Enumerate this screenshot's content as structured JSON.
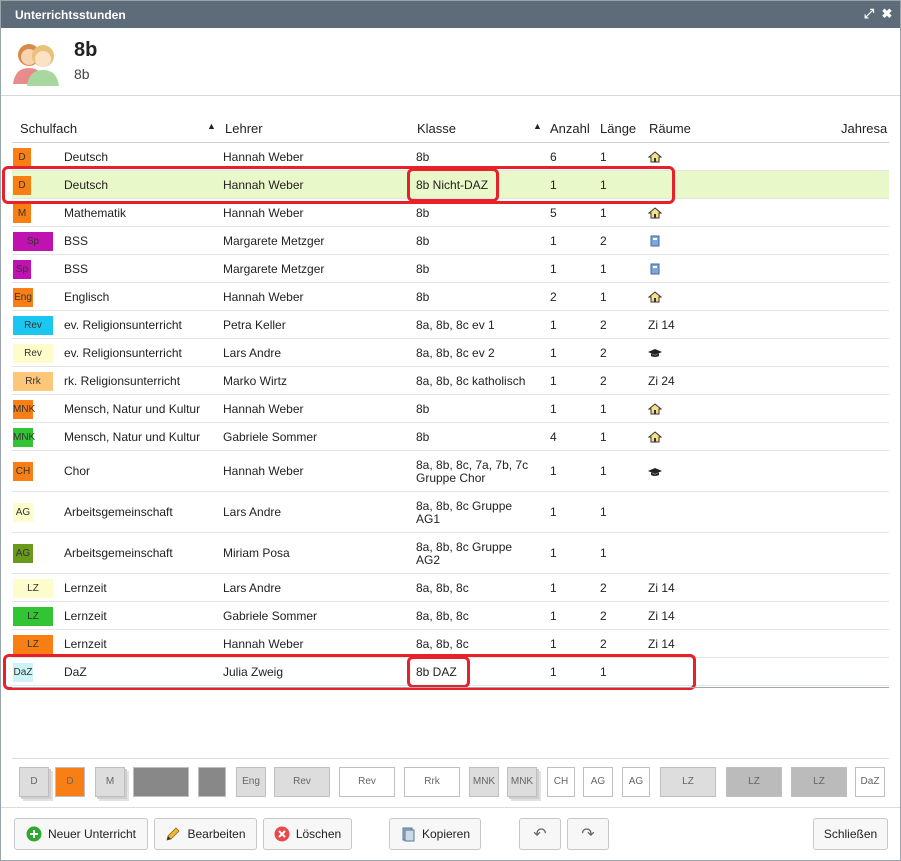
{
  "window": {
    "title": "Unterrichtsstunden"
  },
  "header": {
    "title": "8b",
    "subtitle": "8b"
  },
  "columns": {
    "schulfach": "Schulfach",
    "lehrer": "Lehrer",
    "klasse": "Klasse",
    "anzahl": "Anzahl",
    "laenge": "Länge",
    "raeume": "Räume",
    "jahresa": "Jahresa"
  },
  "rows": [
    {
      "chip": "D",
      "chipColor": "#f97f15",
      "chipW": 18,
      "fach": "Deutsch",
      "lehrer": "Hannah Weber",
      "klasse": [
        "8b"
      ],
      "anzahl": "6",
      "laenge": "1",
      "raum": "",
      "roomIcon": "house"
    },
    {
      "chip": "D",
      "chipColor": "#f97f15",
      "chipW": 18,
      "fach": "Deutsch",
      "lehrer": "Hannah Weber",
      "klasse": [
        "8b Nicht-DAZ"
      ],
      "anzahl": "1",
      "laenge": "1",
      "raum": "",
      "roomIcon": ""
    },
    {
      "chip": "M",
      "chipColor": "#f97f15",
      "chipW": 18,
      "fach": "Mathematik",
      "lehrer": "Hannah Weber",
      "klasse": [
        "8b"
      ],
      "anzahl": "5",
      "laenge": "1",
      "raum": "",
      "roomIcon": "house"
    },
    {
      "chip": "Sp",
      "chipColor": "#c012b0",
      "chipW": 40,
      "fach": "BSS",
      "lehrer": "Margarete Metzger",
      "klasse": [
        "8b"
      ],
      "anzahl": "1",
      "laenge": "2",
      "raum": "",
      "roomIcon": "book"
    },
    {
      "chip": "Sp",
      "chipColor": "#c012b0",
      "chipW": 18,
      "fach": "BSS",
      "lehrer": "Margarete Metzger",
      "klasse": [
        "8b"
      ],
      "anzahl": "1",
      "laenge": "1",
      "raum": "",
      "roomIcon": "book"
    },
    {
      "chip": "Eng",
      "chipColor": "#f97f15",
      "chipW": 20,
      "fach": "Englisch",
      "lehrer": "Hannah Weber",
      "klasse": [
        "8b"
      ],
      "anzahl": "2",
      "laenge": "1",
      "raum": "",
      "roomIcon": "house"
    },
    {
      "chip": "Rev",
      "chipColor": "#1bc6f0",
      "chipW": 40,
      "fach": "ev. Religionsunterricht",
      "lehrer": "Petra Keller",
      "klasse": [
        "8a, 8b, 8c ev 1"
      ],
      "anzahl": "1",
      "laenge": "2",
      "raum": "Zi 14",
      "roomIcon": ""
    },
    {
      "chip": "Rev",
      "chipColor": "#fdfdcc",
      "chipW": 40,
      "fach": "ev. Religionsunterricht",
      "lehrer": "Lars Andre",
      "klasse": [
        "8a, 8b, 8c ev 2"
      ],
      "anzahl": "1",
      "laenge": "2",
      "raum": "",
      "roomIcon": "cap"
    },
    {
      "chip": "Rrk",
      "chipColor": "#fdc77a",
      "chipW": 40,
      "fach": "rk. Religionsunterricht",
      "lehrer": "Marko Wirtz",
      "klasse": [
        "8a, 8b, 8c katholisch"
      ],
      "anzahl": "1",
      "laenge": "2",
      "raum": "Zi 24",
      "roomIcon": ""
    },
    {
      "chip": "MNK",
      "chipColor": "#f97f15",
      "chipW": 20,
      "fach": "Mensch, Natur und Kultur",
      "lehrer": "Hannah Weber",
      "klasse": [
        "8b"
      ],
      "anzahl": "1",
      "laenge": "1",
      "raum": "",
      "roomIcon": "house"
    },
    {
      "chip": "MNK",
      "chipColor": "#33c433",
      "chipW": 20,
      "fach": "Mensch, Natur und Kultur",
      "lehrer": "Gabriele Sommer",
      "klasse": [
        "8b"
      ],
      "anzahl": "4",
      "laenge": "1",
      "raum": "",
      "roomIcon": "house"
    },
    {
      "chip": "CH",
      "chipColor": "#f97f15",
      "chipW": 20,
      "fach": "Chor",
      "lehrer": "Hannah Weber",
      "klasse": [
        "8a, 8b, 8c, 7a, 7b, 7c",
        "Gruppe Chor"
      ],
      "anzahl": "1",
      "laenge": "1",
      "raum": "",
      "roomIcon": "cap"
    },
    {
      "chip": "AG",
      "chipColor": "#fdfdcc",
      "chipW": 20,
      "fach": "Arbeitsgemeinschaft",
      "lehrer": "Lars Andre",
      "klasse": [
        "8a, 8b, 8c Gruppe",
        "AG1"
      ],
      "anzahl": "1",
      "laenge": "1",
      "raum": "",
      "roomIcon": ""
    },
    {
      "chip": "AG",
      "chipColor": "#6a9a1a",
      "chipW": 20,
      "fach": "Arbeitsgemeinschaft",
      "lehrer": "Miriam Posa",
      "klasse": [
        "8a, 8b, 8c Gruppe",
        "AG2"
      ],
      "anzahl": "1",
      "laenge": "1",
      "raum": "",
      "roomIcon": ""
    },
    {
      "chip": "LZ",
      "chipColor": "#fdfdcc",
      "chipW": 40,
      "fach": "Lernzeit",
      "lehrer": "Lars Andre",
      "klasse": [
        "8a, 8b, 8c"
      ],
      "anzahl": "1",
      "laenge": "2",
      "raum": "Zi 14",
      "roomIcon": ""
    },
    {
      "chip": "LZ",
      "chipColor": "#33c433",
      "chipW": 40,
      "fach": "Lernzeit",
      "lehrer": "Gabriele Sommer",
      "klasse": [
        "8a, 8b, 8c"
      ],
      "anzahl": "1",
      "laenge": "2",
      "raum": "Zi 14",
      "roomIcon": ""
    },
    {
      "chip": "LZ",
      "chipColor": "#f97f15",
      "chipW": 40,
      "fach": "Lernzeit",
      "lehrer": "Hannah Weber",
      "klasse": [
        "8a, 8b, 8c"
      ],
      "anzahl": "1",
      "laenge": "2",
      "raum": "Zi 14",
      "roomIcon": ""
    },
    {
      "chip": "DaZ",
      "chipColor": "#ccf4f8",
      "chipW": 20,
      "fach": "DaZ",
      "lehrer": "Julia Zweig",
      "klasse": [
        "8b DAZ"
      ],
      "anzahl": "1",
      "laenge": "1",
      "raum": "",
      "roomIcon": ""
    }
  ],
  "palette": [
    {
      "label": "D"
    },
    {
      "label": "D"
    },
    {
      "label": "M"
    },
    {
      "label": ""
    },
    {
      "label": ""
    },
    {
      "label": "Eng"
    },
    {
      "label": "Rev"
    },
    {
      "label": "Rev"
    },
    {
      "label": "Rrk"
    },
    {
      "label": "MNK"
    },
    {
      "label": "MNK"
    },
    {
      "label": "CH"
    },
    {
      "label": "AG"
    },
    {
      "label": "AG"
    },
    {
      "label": "LZ"
    },
    {
      "label": "LZ"
    },
    {
      "label": "LZ"
    },
    {
      "label": "DaZ"
    }
  ],
  "buttons": {
    "neu": "Neuer Unterricht",
    "bearbeiten": "Bearbeiten",
    "loeschen": "Löschen",
    "kopieren": "Kopieren",
    "schliessen": "Schließen"
  }
}
